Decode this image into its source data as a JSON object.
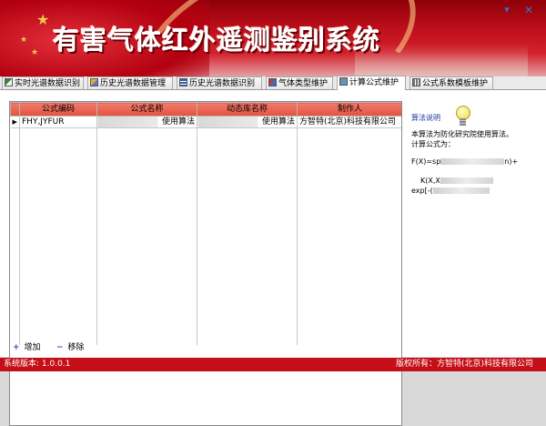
{
  "app": {
    "title": "有害气体红外遥测鉴别系统",
    "window_controls": {
      "minimize": "▾",
      "close": "✕"
    }
  },
  "tabs": [
    {
      "label": "实时光谱数据识别",
      "icon": "realtime-spectrum-icon",
      "active": false
    },
    {
      "label": "历史光谱数据管理",
      "icon": "history-manage-icon",
      "active": false
    },
    {
      "label": "历史光谱数据识别",
      "icon": "history-identify-icon",
      "active": false
    },
    {
      "label": "气体类型维护",
      "icon": "gas-type-icon",
      "active": false
    },
    {
      "label": "计算公式维护",
      "icon": "formula-icon",
      "active": true
    },
    {
      "label": "公式系数模板维护",
      "icon": "coefficient-template-icon",
      "active": false
    }
  ],
  "grid": {
    "columns": [
      "公式编码",
      "公式名称",
      "动态库名称",
      "制作人"
    ],
    "rows": [
      {
        "code": "FHY,JYFUR",
        "name": "使用算法",
        "library": "使用算法",
        "author": "方智特(北京)科技有限公司",
        "selected": true
      }
    ],
    "row_indicator": "▶"
  },
  "algorithm": {
    "label": "算法说明",
    "description": "本算法为防化研究院使用算法。",
    "formula_intro": "计算公式为：",
    "formula_line1_prefix": "F(X)=sp",
    "formula_line1_suffix": "n)+",
    "formula_line2_prefix": "K(X,X",
    "formula_line3_prefix": "exp[-(",
    "bulb_icon": "lightbulb-icon"
  },
  "actions": {
    "add": {
      "label": "增加",
      "symbol": "+"
    },
    "remove": {
      "label": "移除",
      "symbol": "−"
    }
  },
  "status": {
    "version": "系统版本: 1.0.0.1",
    "copyright": "版权所有：方智特(北京)科技有限公司"
  },
  "colors": {
    "banner_red": "#c0101c",
    "header_red": "#e3523f",
    "status_red": "#c50f18",
    "link_blue": "#1a3a9e"
  }
}
